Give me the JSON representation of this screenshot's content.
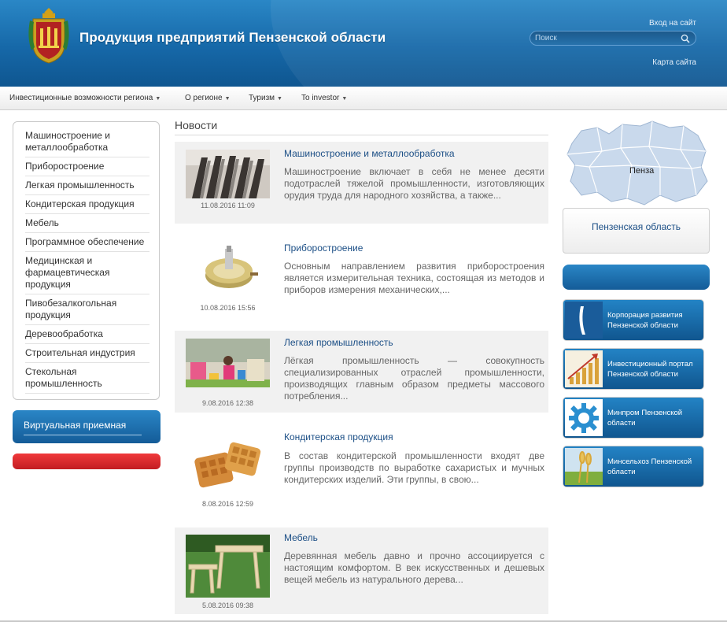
{
  "header": {
    "title": "Продукция предприятий Пензенской области",
    "login": "Вход на сайт",
    "search_placeholder": "Поиск",
    "sitemap": "Карта сайта",
    "colors": {
      "primary": "#1668a8",
      "accent_red": "#d62a2e",
      "link": "#1c4f86"
    }
  },
  "nav": {
    "items": [
      {
        "label": "Инвестиционные возможности региона"
      },
      {
        "label": "О регионе"
      },
      {
        "label": "Туризм"
      },
      {
        "label": "To investor"
      }
    ]
  },
  "sidebar": {
    "items": [
      {
        "label": "Машиностроение и металлообработка"
      },
      {
        "label": "Приборостроение"
      },
      {
        "label": "Легкая промышленность"
      },
      {
        "label": "Кондитерская продукция"
      },
      {
        "label": "Мебель"
      },
      {
        "label": "Программное обеспечение"
      },
      {
        "label": "Медицинская и фармацевтическая продукция"
      },
      {
        "label": "Пивобезалкогольная продукция"
      },
      {
        "label": "Деревообработка"
      },
      {
        "label": "Строительная индустрия"
      },
      {
        "label": "Стекольная промышленность"
      }
    ],
    "virtual_reception": "Виртуальная приемная"
  },
  "news": {
    "title": "Новости",
    "items": [
      {
        "title": "Машиностроение и металлообработка",
        "text": "Машиностроение включает в себя не менее десяти подотраслей тяжелой промышленности, изготовляющих орудия труда для народного хозяйства, а также...",
        "date": "11.08.2016 11:09"
      },
      {
        "title": "Приборостроение",
        "text": "Основным направлением развития приборостроения является измерительная техника, состоящая из методов и приборов измерения механических,...",
        "date": "10.08.2016 15:56"
      },
      {
        "title": "Легкая промышленность",
        "text": "Лёгкая промышленность — совокупность специализированных отраслей промышленности, производящих главным образом предметы массового потребления...",
        "date": "9.08.2016 12:38"
      },
      {
        "title": "Кондитерская продукция",
        "text": "В состав кондитерской промышленности входят две группы производств по выработке сахаристых и мучных кондитерских изделий. Эти группы, в свою...",
        "date": "8.08.2016 12:59"
      },
      {
        "title": "Мебель",
        "text": "Деревянная мебель давно и прочно ассоциируется с настоящим комфортом. В век искусственных и дешевых вещей мебель из натурального дерева...",
        "date": "5.08.2016 09:38"
      }
    ]
  },
  "right": {
    "map_label": "Пенза",
    "region_link": "Пензенская область",
    "banners": [
      {
        "label": "Корпорация развития Пензенской области",
        "icon": "corporation-logo-icon"
      },
      {
        "label": "Инвестиционный портал Пензенской области",
        "icon": "growth-chart-icon"
      },
      {
        "label": "Минпром Пензенской области",
        "icon": "gear-icon"
      },
      {
        "label": "Минсельхоз Пензенской области",
        "icon": "wheat-icon"
      }
    ]
  }
}
